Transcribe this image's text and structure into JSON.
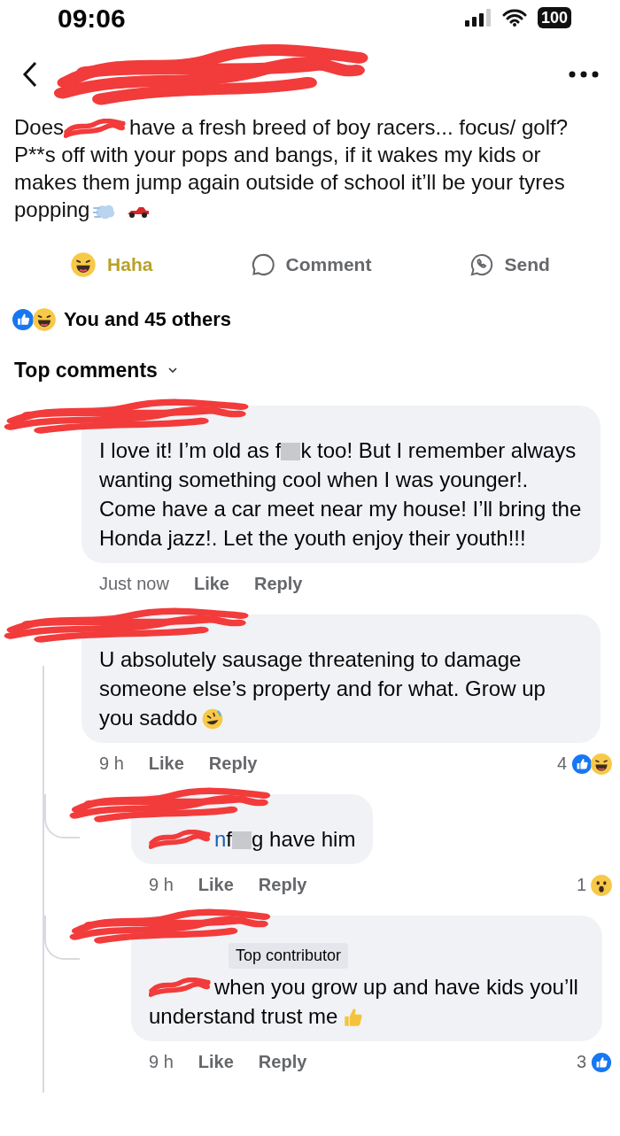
{
  "status_bar": {
    "time": "09:06",
    "battery": "100"
  },
  "post": {
    "segments": [
      {
        "kind": "text",
        "text": "Does"
      },
      {
        "kind": "redacted"
      },
      {
        "kind": "text",
        "text": "have a fresh breed of boy racers... focus/ golf? P**s off with your pops and bangs, if it wakes my kids or makes them jump again outside of school it’ll be your tyres popping"
      },
      {
        "kind": "wind"
      },
      {
        "kind": "car"
      }
    ]
  },
  "actions": [
    {
      "kind": "haha",
      "label": "Haha",
      "selected": true
    },
    {
      "kind": "comment",
      "label": "Comment",
      "selected": false
    },
    {
      "kind": "send",
      "label": "Send",
      "selected": false
    }
  ],
  "reactions_summary": {
    "reactions": [
      {
        "kind": "like"
      },
      {
        "kind": "haha"
      }
    ],
    "text": "You and 45 others"
  },
  "comments_header": "Top comments",
  "comments": [
    {
      "segments": [
        {
          "kind": "text",
          "text": "I love it! I’m old as f"
        },
        {
          "kind": "censored"
        },
        {
          "kind": "text",
          "text": "k too! But I remember always wanting something cool when I was younger!. Come have a car meet near my house! I’ll bring the Honda jazz!. Let the youth enjoy their youth!!!"
        }
      ],
      "time": "Just now",
      "like": "Like",
      "reply": "Reply"
    },
    {
      "segments": [
        {
          "kind": "text",
          "text": "U absolutely sausage threatening to damage someone else’s property and for what. Grow up you saddo"
        },
        {
          "kind": "rofl"
        }
      ],
      "time": "9 h",
      "like": "Like",
      "reply": "Reply",
      "count": "4",
      "reactions": [
        {
          "kind": "like"
        },
        {
          "kind": "haha"
        }
      ],
      "children": [
        {
          "segments": [
            {
              "kind": "redacted"
            },
            {
              "kind": "mention",
              "text": "n"
            },
            {
              "kind": "text",
              "text": "f"
            },
            {
              "kind": "censored"
            },
            {
              "kind": "text",
              "text": "g have him"
            }
          ],
          "time": "9 h",
          "like": "Like",
          "reply": "Reply",
          "count": "1",
          "reactions": [
            {
              "kind": "wow"
            }
          ]
        },
        {
          "badge": "Top contributor",
          "segments": [
            {
              "kind": "redacted"
            },
            {
              "kind": "text",
              "text": "when you grow up and have kids you’ll understand trust me"
            },
            {
              "kind": "thumbs"
            }
          ],
          "time": "9 h",
          "like": "Like",
          "reply": "Reply",
          "count": "3",
          "reactions": [
            {
              "kind": "like"
            }
          ]
        }
      ]
    }
  ]
}
